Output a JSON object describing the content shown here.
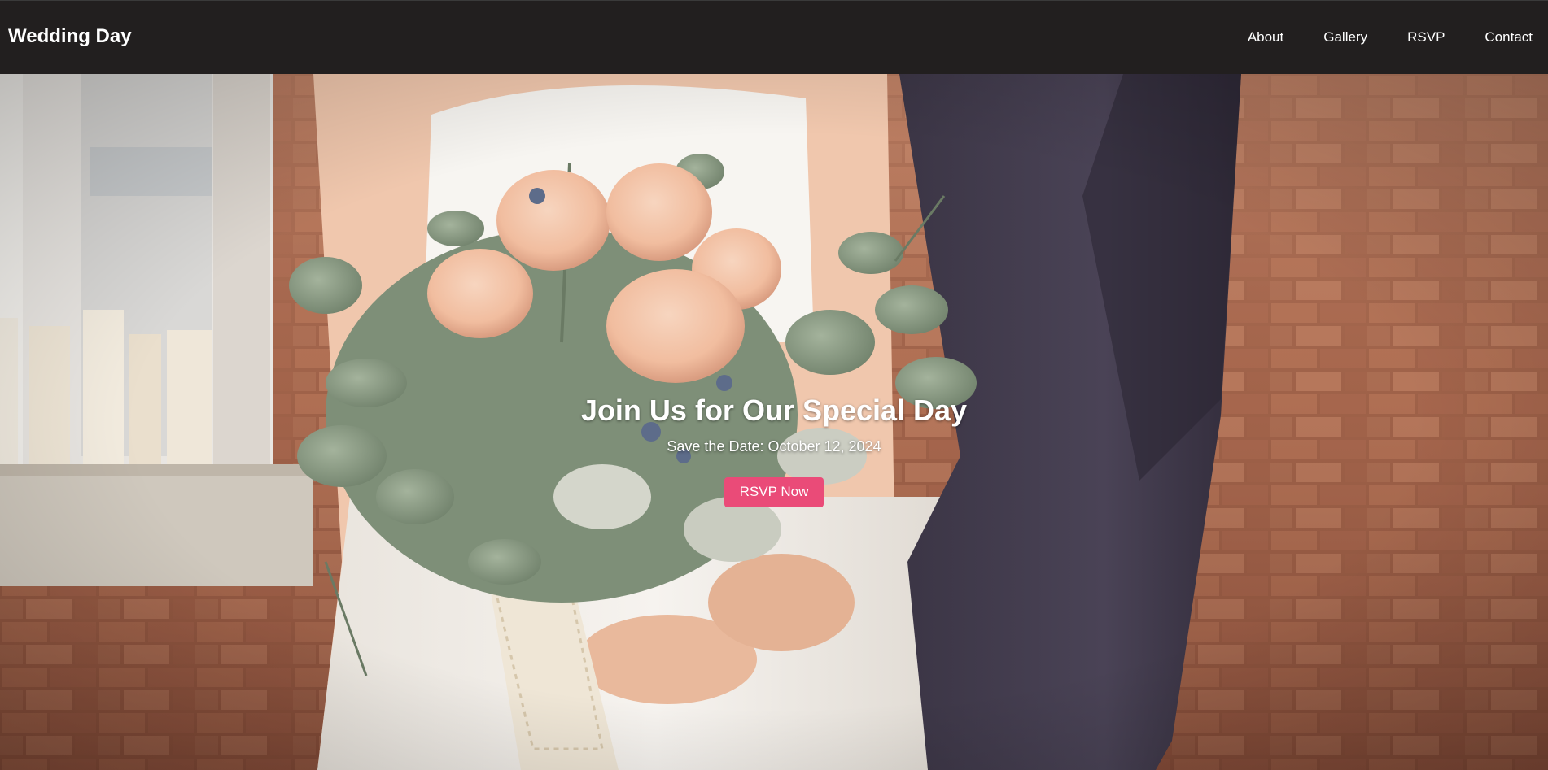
{
  "header": {
    "brand": "Wedding Day",
    "nav": [
      {
        "label": "About"
      },
      {
        "label": "Gallery"
      },
      {
        "label": "RSVP"
      },
      {
        "label": "Contact"
      }
    ]
  },
  "hero": {
    "title": "Join Us for Our Special Day",
    "subtitle": "Save the Date: October 12, 2024",
    "cta_label": "RSVP Now",
    "background_image": "bride and groom holding a bouquet of peach roses and eucalyptus"
  },
  "colors": {
    "header_bg": "#221f1f",
    "accent": "#ea4b78",
    "text": "#ffffff"
  }
}
